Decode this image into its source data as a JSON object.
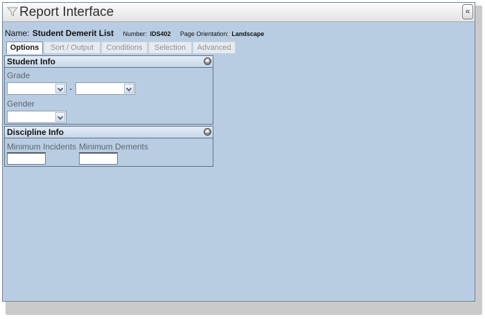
{
  "window": {
    "title": "Report Interface",
    "collapse_label": "«"
  },
  "report": {
    "name_label": "Name:",
    "name": "Student Demerit List",
    "number_label": "Number:",
    "number": "IDS402",
    "orientation_label": "Page Orientation:",
    "orientation": "Landscape"
  },
  "tabs": [
    {
      "label": "Options",
      "active": true
    },
    {
      "label": "Sort / Output",
      "active": false
    },
    {
      "label": "Conditions",
      "active": false
    },
    {
      "label": "Selection",
      "active": false
    },
    {
      "label": "Advanced",
      "active": false
    }
  ],
  "student_info": {
    "header": "Student Info",
    "grade_label": "Grade",
    "grade_from": "",
    "grade_separator": "-",
    "grade_to": "",
    "gender_label": "Gender",
    "gender": ""
  },
  "discipline_info": {
    "header": "Discipline Info",
    "min_incidents_label": "Minimum Incidents",
    "min_incidents": "",
    "min_demerits_label": "Minimum Demerits",
    "min_demerits": ""
  },
  "colors": {
    "panel_bg": "#b9cde2",
    "border": "#5d7088"
  }
}
